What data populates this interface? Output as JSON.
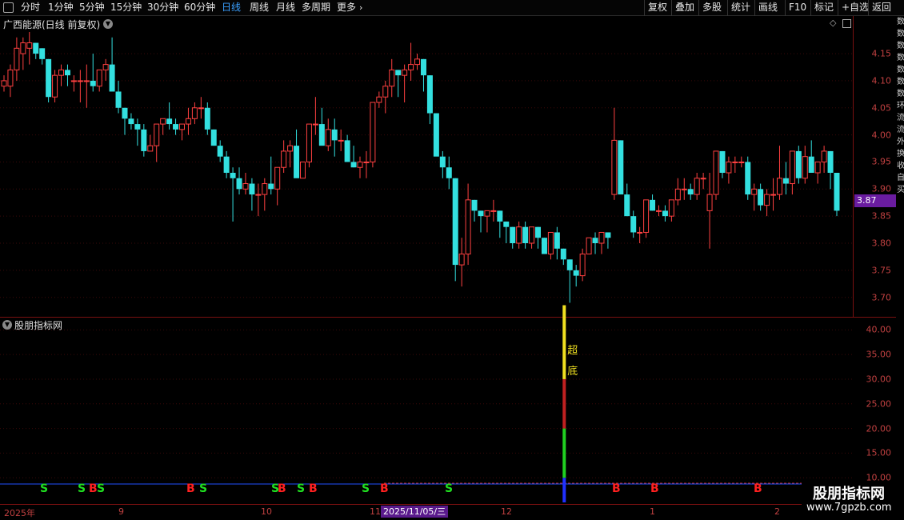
{
  "toolbar": {
    "periods": [
      "分时",
      "1分钟",
      "5分钟",
      "15分钟",
      "30分钟",
      "60分钟",
      "日线",
      "周线",
      "月线",
      "多周期",
      "更多"
    ],
    "active": "日线",
    "right_buttons": [
      "复权",
      "叠加",
      "多股",
      "统计",
      "画线",
      "F10",
      "标记",
      "+自选",
      "返回"
    ]
  },
  "main_title": "广西能源(日线 前复权)",
  "indicator_title": "股朋指标网",
  "price_axis": [
    "4.15",
    "4.10",
    "4.05",
    "4.00",
    "3.95",
    "3.90",
    "3.85",
    "3.80",
    "3.75",
    "3.70"
  ],
  "current_price": "3.87",
  "indicator_axis": [
    "40.00",
    "35.00",
    "30.00",
    "25.00",
    "20.00",
    "15.00",
    "10.00"
  ],
  "date_labels": [
    "2025年",
    "9",
    "10",
    "11",
    "12",
    "1",
    "2"
  ],
  "selected_date": "2025/11/05/三",
  "signal_text": [
    "超",
    "底"
  ],
  "signals": [
    "S",
    "S",
    "B",
    "S",
    "B",
    "S",
    "S",
    "B",
    "S",
    "B",
    "S",
    "B",
    "S",
    "B",
    "B",
    "B"
  ],
  "watermark": {
    "line1": "股朋指标网",
    "line2": "www.7gpzb.com"
  },
  "side_text": [
    "数",
    "数",
    "数",
    "数",
    "数",
    "数",
    "数",
    "环",
    "流",
    "流",
    "外",
    "换",
    "收",
    "自",
    "买"
  ],
  "colors": {
    "up": "#ff4040",
    "down": "#33e0e0",
    "axis": "#c04040",
    "active": "#3aa0ff"
  },
  "chart_data": {
    "type": "candlestick",
    "ylim": [
      3.67,
      4.19
    ],
    "candles": [
      [
        4.09,
        4.11,
        4.08,
        4.1
      ],
      [
        4.09,
        4.13,
        4.07,
        4.12
      ],
      [
        4.12,
        4.18,
        4.1,
        4.16
      ],
      [
        4.15,
        4.18,
        4.12,
        4.17
      ],
      [
        4.16,
        4.19,
        4.13,
        4.17
      ],
      [
        4.17,
        4.17,
        4.14,
        4.15
      ],
      [
        4.16,
        4.16,
        4.13,
        4.14
      ],
      [
        4.14,
        4.14,
        4.06,
        4.07
      ],
      [
        4.07,
        4.12,
        4.06,
        4.11
      ],
      [
        4.11,
        4.13,
        4.09,
        4.12
      ],
      [
        4.12,
        4.13,
        4.09,
        4.11
      ],
      [
        4.1,
        4.11,
        4.08,
        4.1
      ],
      [
        4.1,
        4.12,
        4.06,
        4.1
      ],
      [
        4.1,
        4.13,
        4.05,
        4.1
      ],
      [
        4.1,
        4.15,
        4.08,
        4.09
      ],
      [
        4.09,
        4.12,
        4.08,
        4.12
      ],
      [
        4.12,
        4.14,
        4.1,
        4.13
      ],
      [
        4.13,
        4.18,
        4.1,
        4.08
      ],
      [
        4.08,
        4.1,
        4.04,
        4.05
      ],
      [
        4.05,
        4.05,
        4.0,
        4.03
      ],
      [
        4.03,
        4.04,
        4.01,
        4.02
      ],
      [
        4.02,
        4.03,
        3.98,
        4.01
      ],
      [
        4.01,
        4.02,
        3.96,
        3.97
      ],
      [
        3.97,
        4.0,
        3.97,
        3.98
      ],
      [
        3.98,
        4.0,
        3.95,
        4.02
      ],
      [
        4.02,
        4.03,
        4.0,
        4.03
      ],
      [
        4.03,
        4.06,
        4.01,
        4.02
      ],
      [
        4.02,
        4.03,
        4.0,
        4.01
      ],
      [
        4.01,
        4.02,
        3.99,
        4.02
      ],
      [
        4.02,
        4.05,
        4.0,
        4.03
      ],
      [
        4.03,
        4.06,
        4.02,
        4.05
      ],
      [
        4.05,
        4.07,
        4.03,
        4.05
      ],
      [
        4.05,
        4.06,
        4.0,
        4.01
      ],
      [
        4.01,
        4.01,
        3.98,
        3.98
      ],
      [
        3.98,
        3.99,
        3.95,
        3.96
      ],
      [
        3.96,
        3.97,
        3.92,
        3.93
      ],
      [
        3.93,
        3.94,
        3.84,
        3.92
      ],
      [
        3.92,
        3.94,
        3.89,
        3.9
      ],
      [
        3.9,
        3.93,
        3.89,
        3.91
      ],
      [
        3.91,
        3.92,
        3.86,
        3.89
      ],
      [
        3.89,
        3.91,
        3.85,
        3.89
      ],
      [
        3.89,
        3.92,
        3.86,
        3.91
      ],
      [
        3.91,
        3.96,
        3.89,
        3.9
      ],
      [
        3.9,
        3.94,
        3.87,
        3.94
      ],
      [
        3.94,
        3.99,
        3.93,
        3.97
      ],
      [
        3.97,
        3.99,
        3.94,
        3.98
      ],
      [
        3.98,
        4.01,
        3.96,
        3.92
      ],
      [
        3.92,
        3.95,
        3.92,
        3.95
      ],
      [
        3.95,
        4.0,
        3.94,
        4.02
      ],
      [
        4.02,
        4.07,
        4.0,
        4.02
      ],
      [
        4.02,
        4.05,
        3.99,
        3.98
      ],
      [
        3.98,
        4.03,
        3.97,
        4.01
      ],
      [
        4.01,
        4.03,
        3.96,
        3.99
      ],
      [
        3.99,
        4.01,
        3.97,
        3.99
      ],
      [
        3.99,
        4.0,
        3.95,
        3.95
      ],
      [
        3.95,
        3.98,
        3.94,
        3.94
      ],
      [
        3.94,
        3.96,
        3.92,
        3.95
      ],
      [
        3.95,
        3.97,
        3.92,
        3.95
      ],
      [
        3.95,
        4.06,
        3.94,
        4.06
      ],
      [
        4.06,
        4.08,
        4.05,
        4.07
      ],
      [
        4.07,
        4.1,
        4.04,
        4.09
      ],
      [
        4.09,
        4.14,
        4.07,
        4.12
      ],
      [
        4.12,
        4.12,
        4.07,
        4.11
      ],
      [
        4.11,
        4.13,
        4.06,
        4.12
      ],
      [
        4.12,
        4.17,
        4.1,
        4.13
      ],
      [
        4.13,
        4.15,
        4.12,
        4.14
      ],
      [
        4.14,
        4.14,
        4.08,
        4.11
      ],
      [
        4.11,
        4.11,
        4.02,
        4.04
      ],
      [
        4.04,
        4.04,
        3.98,
        3.96
      ],
      [
        3.96,
        3.97,
        3.92,
        3.94
      ],
      [
        3.94,
        3.96,
        3.9,
        3.92
      ],
      [
        3.92,
        3.92,
        3.73,
        3.76
      ],
      [
        3.76,
        3.81,
        3.72,
        3.78
      ],
      [
        3.78,
        3.91,
        3.76,
        3.88
      ],
      [
        3.88,
        3.88,
        3.84,
        3.86
      ],
      [
        3.86,
        3.86,
        3.82,
        3.85
      ],
      [
        3.85,
        3.86,
        3.82,
        3.86
      ],
      [
        3.86,
        3.88,
        3.84,
        3.86
      ],
      [
        3.86,
        3.86,
        3.81,
        3.84
      ],
      [
        3.84,
        3.84,
        3.8,
        3.83
      ],
      [
        3.83,
        3.83,
        3.79,
        3.8
      ],
      [
        3.8,
        3.84,
        3.79,
        3.83
      ],
      [
        3.83,
        3.84,
        3.79,
        3.8
      ],
      [
        3.8,
        3.83,
        3.79,
        3.83
      ],
      [
        3.83,
        3.83,
        3.79,
        3.81
      ],
      [
        3.81,
        3.81,
        3.78,
        3.78
      ],
      [
        3.78,
        3.82,
        3.77,
        3.82
      ],
      [
        3.82,
        3.83,
        3.77,
        3.79
      ],
      [
        3.79,
        3.79,
        3.76,
        3.77
      ],
      [
        3.77,
        3.77,
        3.69,
        3.75
      ],
      [
        3.75,
        3.76,
        3.72,
        3.74
      ],
      [
        3.74,
        3.79,
        3.73,
        3.78
      ],
      [
        3.78,
        3.81,
        3.78,
        3.81
      ],
      [
        3.81,
        3.82,
        3.78,
        3.8
      ],
      [
        3.8,
        3.82,
        3.78,
        3.82
      ],
      [
        3.82,
        3.82,
        3.79,
        3.81
      ],
      [
        3.89,
        4.05,
        3.88,
        3.99
      ],
      [
        3.99,
        3.99,
        3.9,
        3.89
      ],
      [
        3.89,
        3.91,
        3.85,
        3.85
      ],
      [
        3.85,
        3.86,
        3.81,
        3.82
      ],
      [
        3.82,
        3.83,
        3.8,
        3.82
      ],
      [
        3.82,
        3.88,
        3.81,
        3.88
      ],
      [
        3.88,
        3.89,
        3.86,
        3.86
      ],
      [
        3.86,
        3.87,
        3.85,
        3.86
      ],
      [
        3.86,
        3.87,
        3.84,
        3.85
      ],
      [
        3.85,
        3.88,
        3.84,
        3.88
      ],
      [
        3.88,
        3.92,
        3.87,
        3.9
      ],
      [
        3.9,
        3.92,
        3.88,
        3.9
      ],
      [
        3.9,
        3.91,
        3.88,
        3.89
      ],
      [
        3.89,
        3.93,
        3.88,
        3.92
      ],
      [
        3.92,
        3.93,
        3.9,
        3.92
      ],
      [
        3.86,
        3.93,
        3.79,
        3.89
      ],
      [
        3.89,
        3.97,
        3.88,
        3.97
      ],
      [
        3.97,
        3.97,
        3.92,
        3.93
      ],
      [
        3.93,
        3.96,
        3.91,
        3.95
      ],
      [
        3.95,
        3.96,
        3.93,
        3.95
      ],
      [
        3.95,
        3.96,
        3.94,
        3.95
      ],
      [
        3.95,
        3.96,
        3.88,
        3.89
      ],
      [
        3.89,
        3.91,
        3.86,
        3.9
      ],
      [
        3.9,
        3.91,
        3.86,
        3.87
      ],
      [
        3.87,
        3.9,
        3.85,
        3.89
      ],
      [
        3.89,
        3.92,
        3.86,
        3.89
      ],
      [
        3.89,
        3.98,
        3.88,
        3.92
      ],
      [
        3.92,
        3.95,
        3.89,
        3.91
      ],
      [
        3.91,
        3.97,
        3.89,
        3.97
      ],
      [
        3.97,
        3.98,
        3.91,
        3.92
      ],
      [
        3.92,
        3.98,
        3.91,
        3.96
      ],
      [
        3.96,
        3.99,
        3.93,
        3.93
      ],
      [
        3.93,
        3.95,
        3.91,
        3.95
      ],
      [
        3.95,
        3.98,
        3.93,
        3.97
      ],
      [
        3.97,
        3.97,
        3.9,
        3.93
      ],
      [
        3.93,
        3.93,
        3.85,
        3.86
      ]
    ],
    "indicator": {
      "ylim": [
        5,
        42
      ],
      "bar_index": 88,
      "segments": [
        [
          0,
          5,
          "blue"
        ],
        [
          5,
          15,
          "green"
        ],
        [
          15,
          25,
          "red"
        ],
        [
          25,
          40,
          "yellow"
        ]
      ]
    }
  }
}
